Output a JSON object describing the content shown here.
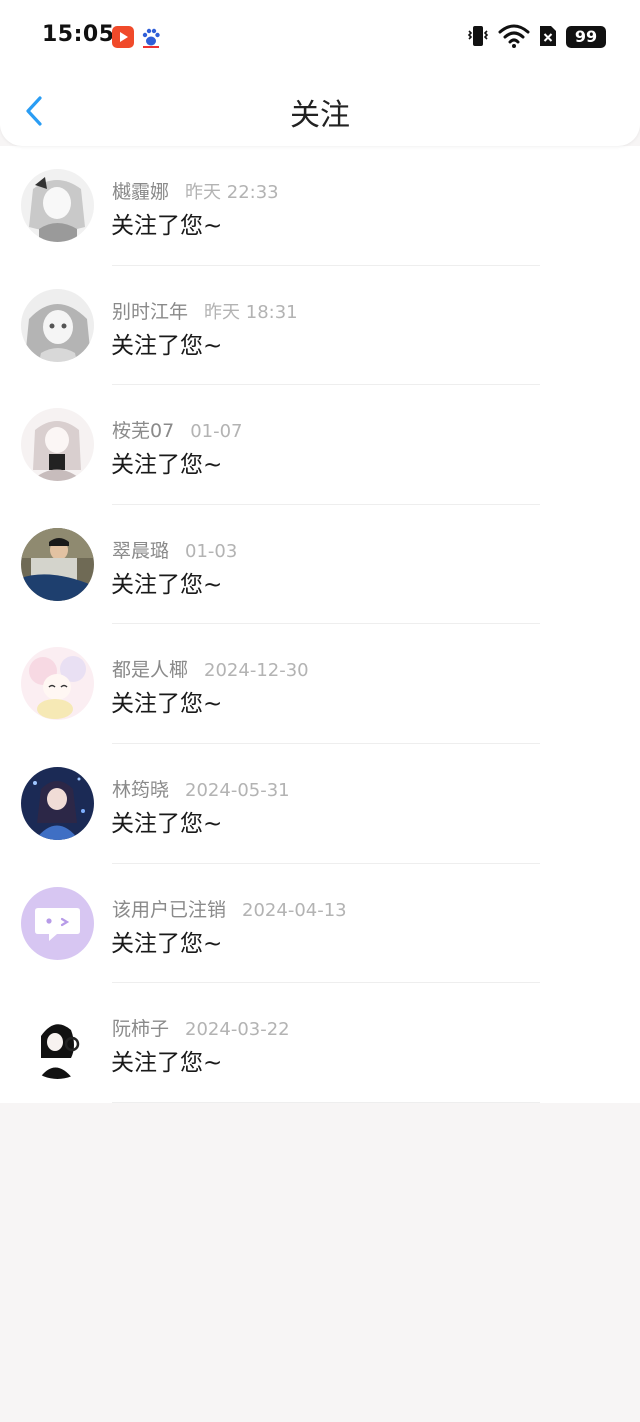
{
  "status_bar": {
    "time": "15:05",
    "battery": "99",
    "icons": [
      "video-app-icon",
      "paw-app-icon",
      "vibrate-icon",
      "wifi-icon",
      "sim-off-icon",
      "battery-icon"
    ]
  },
  "header": {
    "title": "关注",
    "back_icon": "chevron-left-icon"
  },
  "colors": {
    "accent": "#2a9df4",
    "background": "#f7f5f5",
    "username": "#8a8a8a",
    "timestamp": "#b3b3b3",
    "message": "#1a1a1a",
    "deleted_avatar": "#d7c6f2"
  },
  "notifications": [
    {
      "username": "樾霾娜",
      "time": "昨天 22:33",
      "message": "关注了您~"
    },
    {
      "username": "别时江年",
      "time": "昨天 18:31",
      "message": "关注了您~"
    },
    {
      "username": "桉芜07",
      "time": "01-07",
      "message": "关注了您~"
    },
    {
      "username": "翠晨璐",
      "time": "01-03",
      "message": "关注了您~"
    },
    {
      "username": "都是人椰",
      "time": "2024-12-30",
      "message": "关注了您~"
    },
    {
      "username": "林筠晓",
      "time": "2024-05-31",
      "message": "关注了您~"
    },
    {
      "username": "该用户已注销",
      "time": "2024-04-13",
      "message": "关注了您~"
    },
    {
      "username": "阮柿子",
      "time": "2024-03-22",
      "message": "关注了您~"
    }
  ]
}
